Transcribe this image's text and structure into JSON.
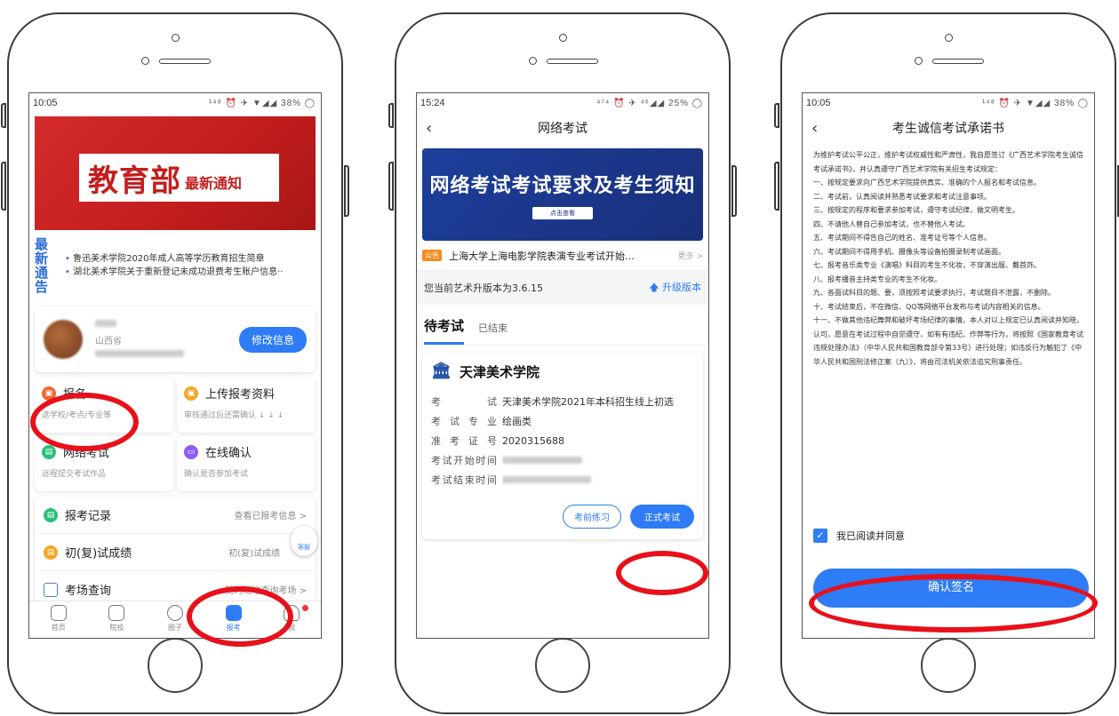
{
  "phone1": {
    "status_time": "10:05",
    "status_icons": "¹⁴⁸ ⏰ ✈ ▼◢◢ 38% ◯",
    "banner": {
      "big": "教育部",
      "small": "最新通知"
    },
    "notice": {
      "label_line1": "最新",
      "label_line2": "通告",
      "items": [
        "鲁迅美术学院2020年成人高等学历教育招生简章",
        "湖北美术学院关于重新登记未成功退费考生账户信息··"
      ]
    },
    "profile": {
      "province": "山西省",
      "edit_label": "修改信息"
    },
    "tiles": [
      {
        "title": "报名",
        "sub": "选学校/考点/专业等",
        "color": "#f0662f"
      },
      {
        "title": "上传报考资料",
        "sub": "审核通过后还需确认 ↓ ↓ ↓",
        "color": "#f5a623"
      },
      {
        "title": "网络考试",
        "sub": "远程提交考试作品",
        "color": "#27c07a"
      },
      {
        "title": "在线确认",
        "sub": "确认是否参加考试",
        "color": "#8b5cf6"
      }
    ],
    "rows": [
      {
        "title": "报考记录",
        "right": "查看已报考信息  >"
      },
      {
        "title": "初(复)试成绩",
        "right": "初(复)试成绩"
      },
      {
        "title": "考场查询",
        "right": "随时随地查询考场  >"
      }
    ],
    "service_label": "客服",
    "tabs": [
      "首页",
      "院校",
      "圈子",
      "报考",
      "我"
    ]
  },
  "phone2": {
    "status_time": "15:24",
    "status_icons": "⁴⁷⁴ ⏰ ✈ ⁴⁶◢◢ 25% ◯",
    "title": "网络考试",
    "banner_title": "网络考试考试要求及考生须知",
    "banner_button": "点击查看",
    "news_tag": "公告",
    "news_text": "上海大学上海电影学院表演专业考试开始…",
    "news_more": "更多  >",
    "version_text": "您当前艺术升版本为3.6.15",
    "upgrade_label": "升级版本",
    "tab_pending": "待考试",
    "tab_done": "已结束",
    "school": "天津美术学院",
    "fields": [
      {
        "k": "考试",
        "v": "天津美术学院2021年本科招生线上初选"
      },
      {
        "k": "考试专业",
        "v": "绘画类"
      },
      {
        "k": "准考证号",
        "v": "2020315688"
      },
      {
        "k": "考试开始时间",
        "v": ""
      },
      {
        "k": "考试结束时间",
        "v": ""
      }
    ],
    "practice_label": "考前练习",
    "exam_label": "正式考试"
  },
  "phone3": {
    "status_time": "10:05",
    "status_icons": "¹⁴⁸ ⏰ ✈ ▼◢◢ 38% ◯",
    "title": "考生诚信考试承诺书",
    "paragraphs": [
      "为维护考试公平公正，维护考试权威性和严肃性，我自愿签订《广西艺术学院考生诚信考试承诺书》，并认真遵守广西艺术学院有关招生考试规定：",
      "一、按规定要求向广西艺术学院提供真实、准确的个人报名和考试信息。",
      "二、考试前，认真阅读并熟悉考试要求和考试注意事项。",
      "三、按规定的程序和要求参加考试，遵守考试纪律，做文明考生。",
      "四、不请他人替自己参加考试，也不替他人考试。",
      "五、考试期间不得告自己的姓名、准考证号等个人信息。",
      "六、考试期间不得用手机、摄像头等设备拍摄录制考试画面。",
      "七、报考音乐类专业《演唱》科目的考生不化妆，不穿演出服、戴首饰。",
      "八、报考播音主持类专业的考生不化妆。",
      "九、各面试科目的题、要，须按照考试要求执行，考试题目不泄露，不删除。",
      "十、考试结束后，不在微信、QQ等网络平台发布与考试内容相关的信息。",
      "十一、不做其他违纪舞弊和破坏考场纪律的事情。本人对以上规定已认真阅读并知晓，认可。愿意在考试过程中自觉遵守，如有有违纪、作弊等行为，将按照《国家教育考试违规处理办法》（中华人民共和国教育部令第33号）进行处理；如违反行为触犯了《中华人民共和国刑法修正案（九）》，将由司法机关依法追究刑事责任。"
    ],
    "agree_label": "我已阅读并同意",
    "sign_label": "确认签名"
  }
}
